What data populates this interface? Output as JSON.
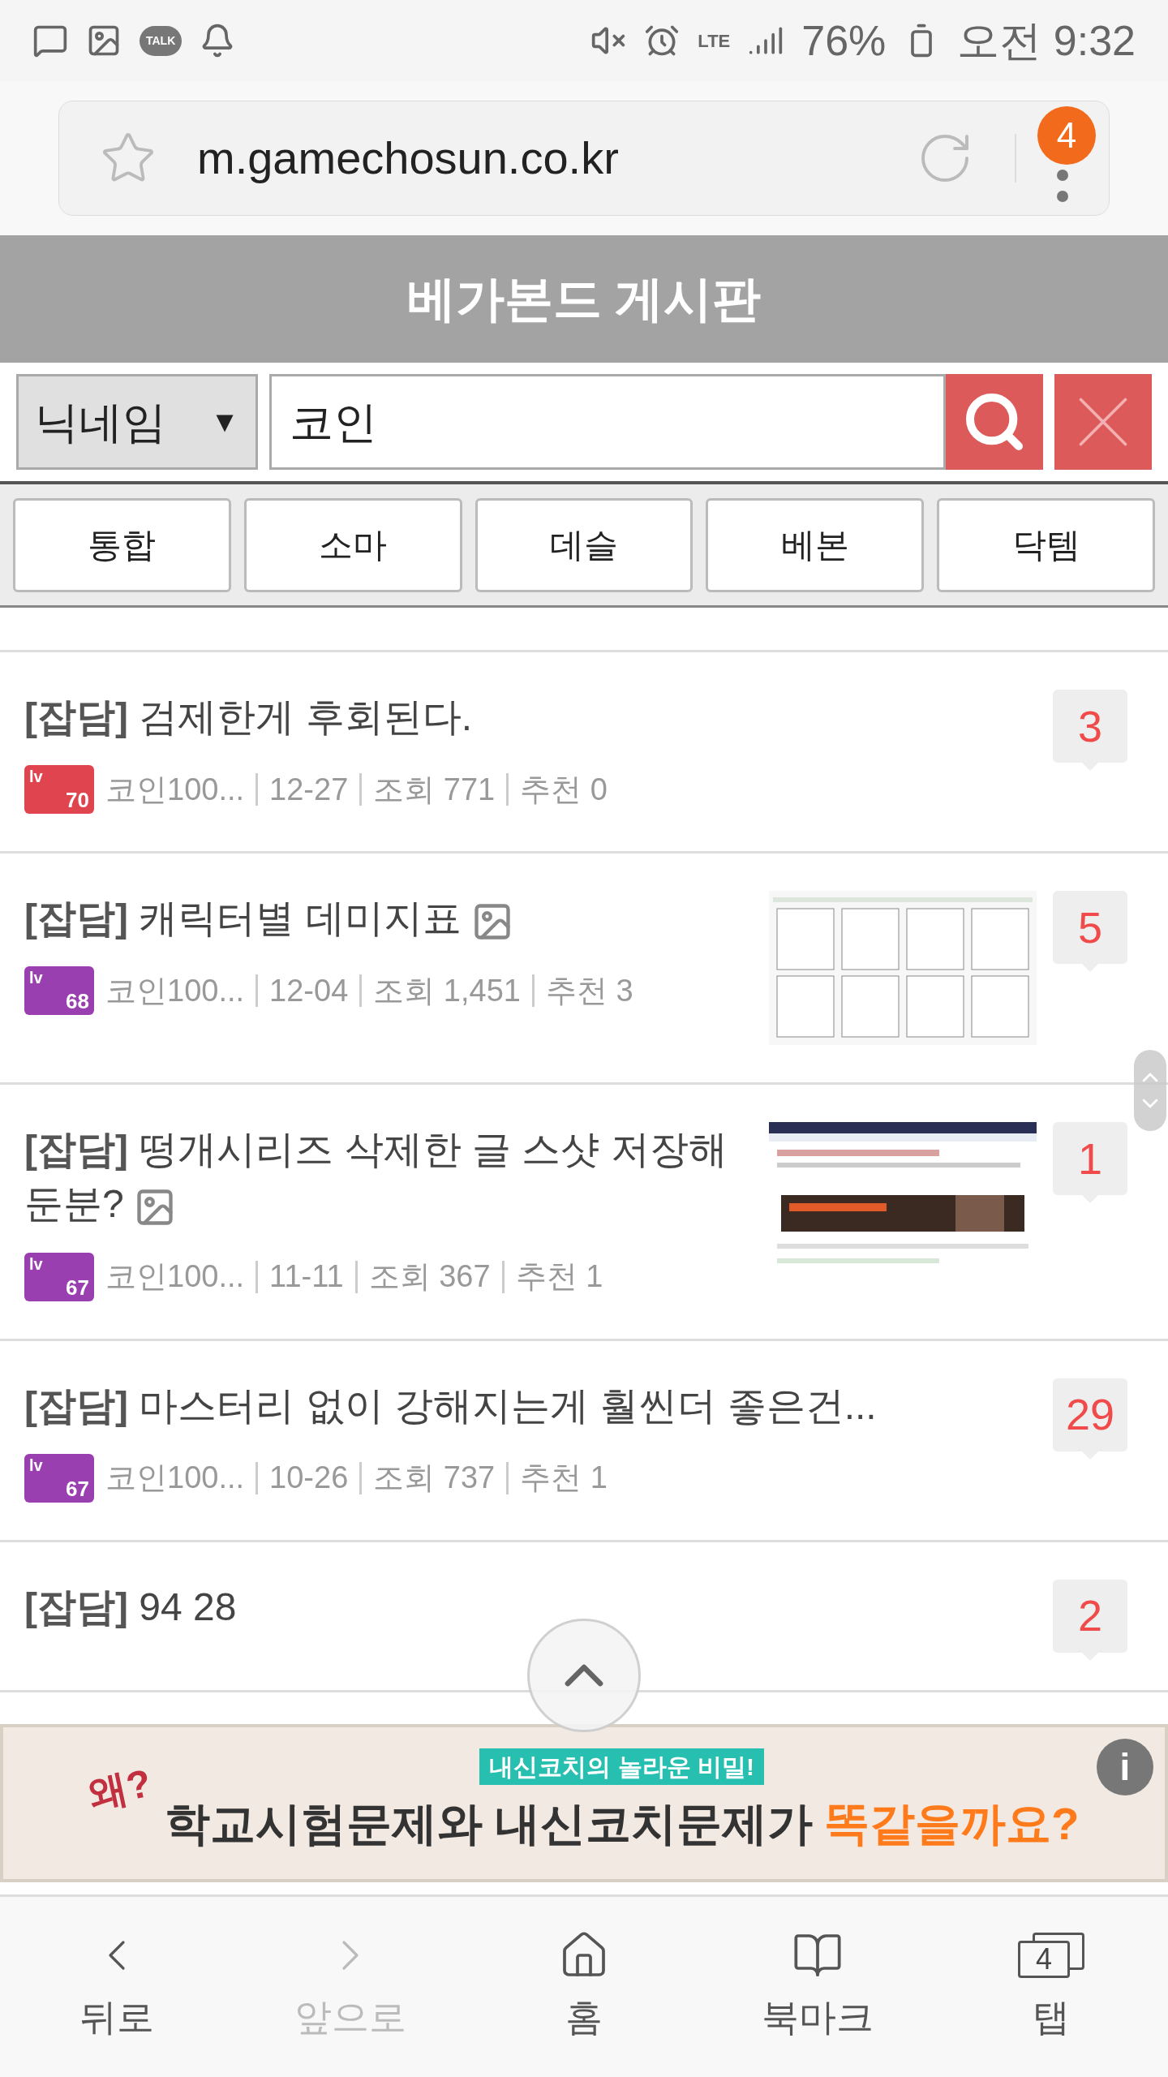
{
  "status_bar": {
    "talk_icon": "TALK",
    "network": "LTE",
    "battery": "76%",
    "time": "오전 9:32"
  },
  "browser": {
    "url": "m.gamechosun.co.kr",
    "menu_badge": "4",
    "bookmarked": false
  },
  "page_title": "베가본드 게시판",
  "search": {
    "field_select": "닉네임",
    "select_arrow": "▼",
    "value": "코인"
  },
  "tabs": [
    {
      "label": "통합"
    },
    {
      "label": "소마"
    },
    {
      "label": "데슬"
    },
    {
      "label": "베본"
    },
    {
      "label": "닥템"
    }
  ],
  "posts": [
    {
      "tag": "[잡담]",
      "title": "검제한게 후회된다.",
      "has_image": false,
      "thumbnail": false,
      "level": {
        "prefix": "lv",
        "number": "70",
        "color": "#e0454f"
      },
      "author": "코인100...",
      "date": "12-27",
      "views": "조회 771",
      "likes": "추천 0",
      "comments": "3"
    },
    {
      "tag": "[잡담]",
      "title": "캐릭터별 데미지표",
      "has_image": true,
      "thumbnail": true,
      "level": {
        "prefix": "lv",
        "number": "68",
        "color": "#9a3fb0"
      },
      "author": "코인100...",
      "date": "12-04",
      "views": "조회 1,451",
      "likes": "추천 3",
      "comments": "5"
    },
    {
      "tag": "[잡담]",
      "title": "떵개시리즈 삭제한 글 스샷 저장해 둔분?",
      "has_image": true,
      "thumbnail": true,
      "level": {
        "prefix": "lv",
        "number": "67",
        "color": "#9a3fb0"
      },
      "author": "코인100...",
      "date": "11-11",
      "views": "조회 367",
      "likes": "추천 1",
      "comments": "1"
    },
    {
      "tag": "[잡담]",
      "title": "마스터리 없이 강해지는게 훨씬더 좋은건...",
      "has_image": false,
      "thumbnail": false,
      "level": {
        "prefix": "lv",
        "number": "67",
        "color": "#9a3fb0"
      },
      "author": "코인100...",
      "date": "10-26",
      "views": "조회 737",
      "likes": "추천 1",
      "comments": "29"
    },
    {
      "tag": "[잡담]",
      "title": "94 28",
      "has_image": false,
      "thumbnail": false,
      "comments": "2"
    }
  ],
  "ad": {
    "question": "왜?",
    "kicker": "내신코치의 놀라운 비밀!",
    "headline": "학교시험문제와 내신코치문제가",
    "highlight": "똑같을까요?",
    "info": "i"
  },
  "bottom_nav": [
    {
      "label": "뒤로",
      "kind": "back",
      "disabled": false
    },
    {
      "label": "앞으로",
      "kind": "forward",
      "disabled": true
    },
    {
      "label": "홈",
      "kind": "home",
      "disabled": false
    },
    {
      "label": "북마크",
      "kind": "bookmark",
      "disabled": false
    },
    {
      "label": "탭",
      "kind": "tabs",
      "disabled": false,
      "count": "4"
    }
  ]
}
